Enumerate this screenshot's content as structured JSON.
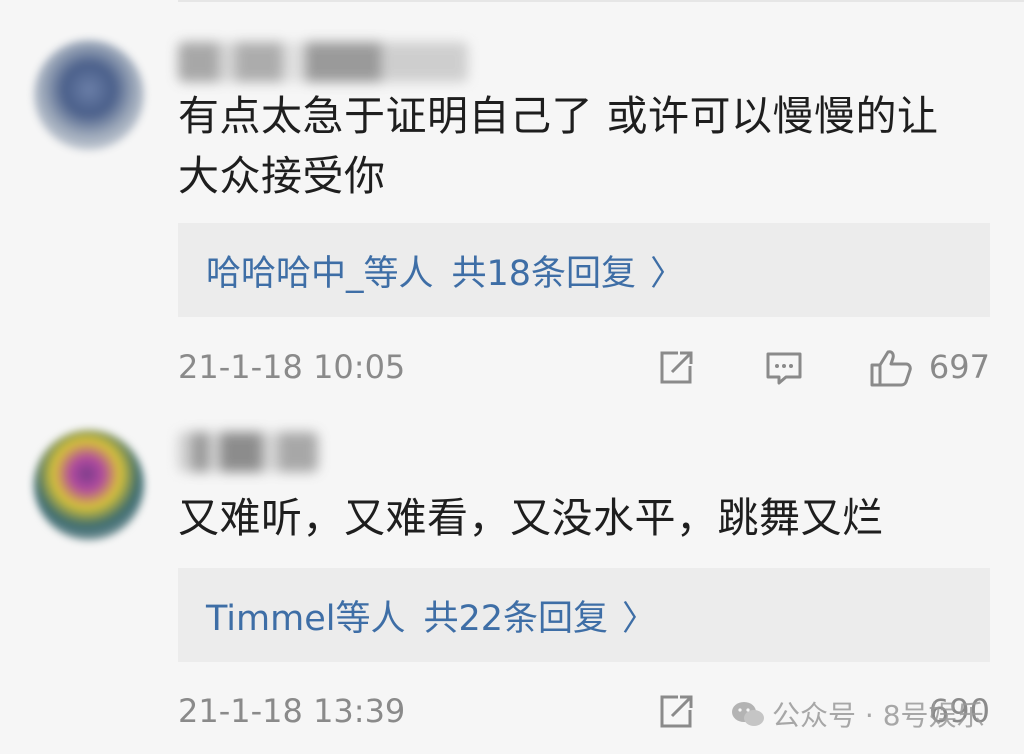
{
  "comments": [
    {
      "content_line1": "有点太急于证明自己了 或许可以慢慢的让",
      "content_line2": "大众接受你",
      "reply_who": "哈哈哈中_等人",
      "reply_count": "共18条回复",
      "reply_chevron": "〉",
      "time": "21-1-18 10:05",
      "likes": "697"
    },
    {
      "content_line1": "又难听，又难看，又没水平，跳舞又烂",
      "reply_who": "Timmel等人",
      "reply_count": "共22条回复",
      "reply_chevron": "〉",
      "time": "21-1-18 13:39",
      "likes": "690"
    }
  ],
  "watermark": {
    "text": "公众号 · 8号娱乐"
  },
  "colors": {
    "link": "#3e6ea6",
    "meta": "#8a8a8a",
    "box": "#ececec",
    "bg": "#f6f6f6"
  },
  "icons": [
    "share-icon",
    "comment-icon",
    "like-icon",
    "wechat-icon"
  ]
}
